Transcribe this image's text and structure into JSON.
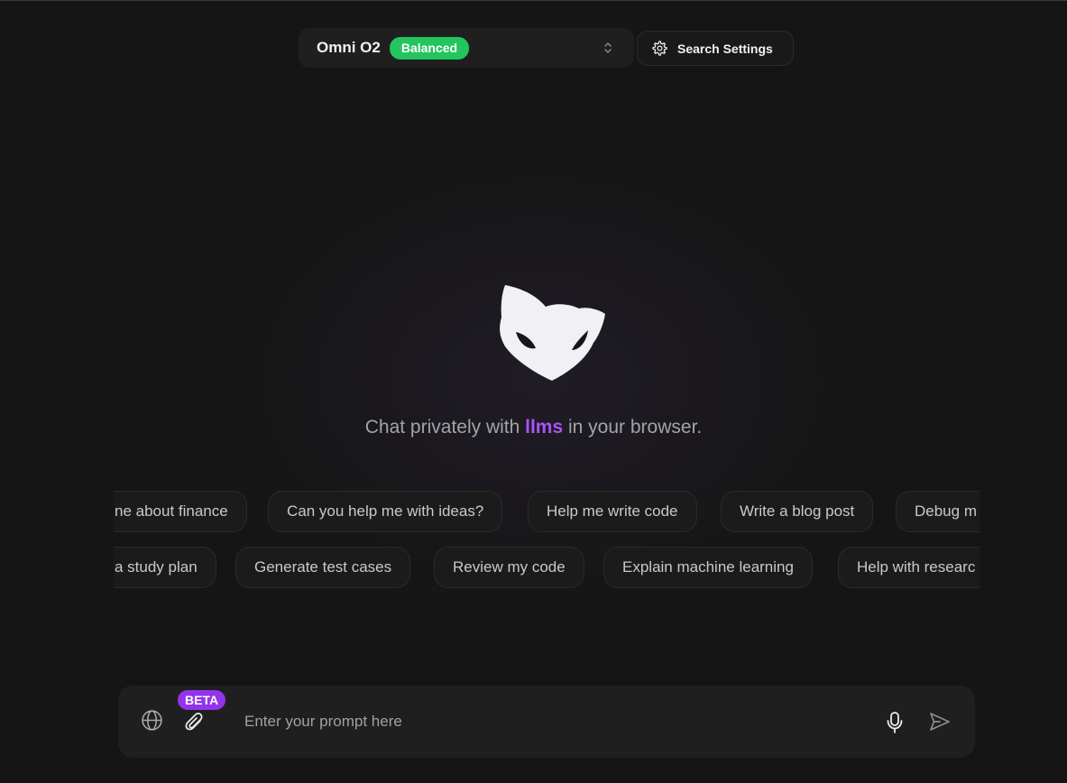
{
  "header": {
    "model_name": "Omni O2",
    "model_badge": "Balanced",
    "search_settings_label": "Search Settings"
  },
  "hero": {
    "tagline_before": "Chat privately with ",
    "tagline_accent": "llms",
    "tagline_after": " in your browser."
  },
  "suggestions": {
    "row1": [
      "ne about finance",
      "Can you help me with ideas?",
      "Help me write code",
      "Write a blog post",
      "Debug m"
    ],
    "row2": [
      "a study plan",
      "Generate test cases",
      "Review my code",
      "Explain machine learning",
      "Help with researc"
    ]
  },
  "prompt": {
    "placeholder": "Enter your prompt here",
    "beta_badge": "BETA"
  },
  "colors": {
    "accent_purple": "#a855f7",
    "badge_green": "#22c55e",
    "beta_purple": "#9333ea",
    "background": "#151515"
  },
  "icons": {
    "settings": "gear-icon",
    "model_select": "chevron-updown-icon",
    "web_search": "globe-icon",
    "attach": "paperclip-icon",
    "voice": "microphone-icon",
    "send": "send-icon",
    "logo": "fox-logo"
  }
}
